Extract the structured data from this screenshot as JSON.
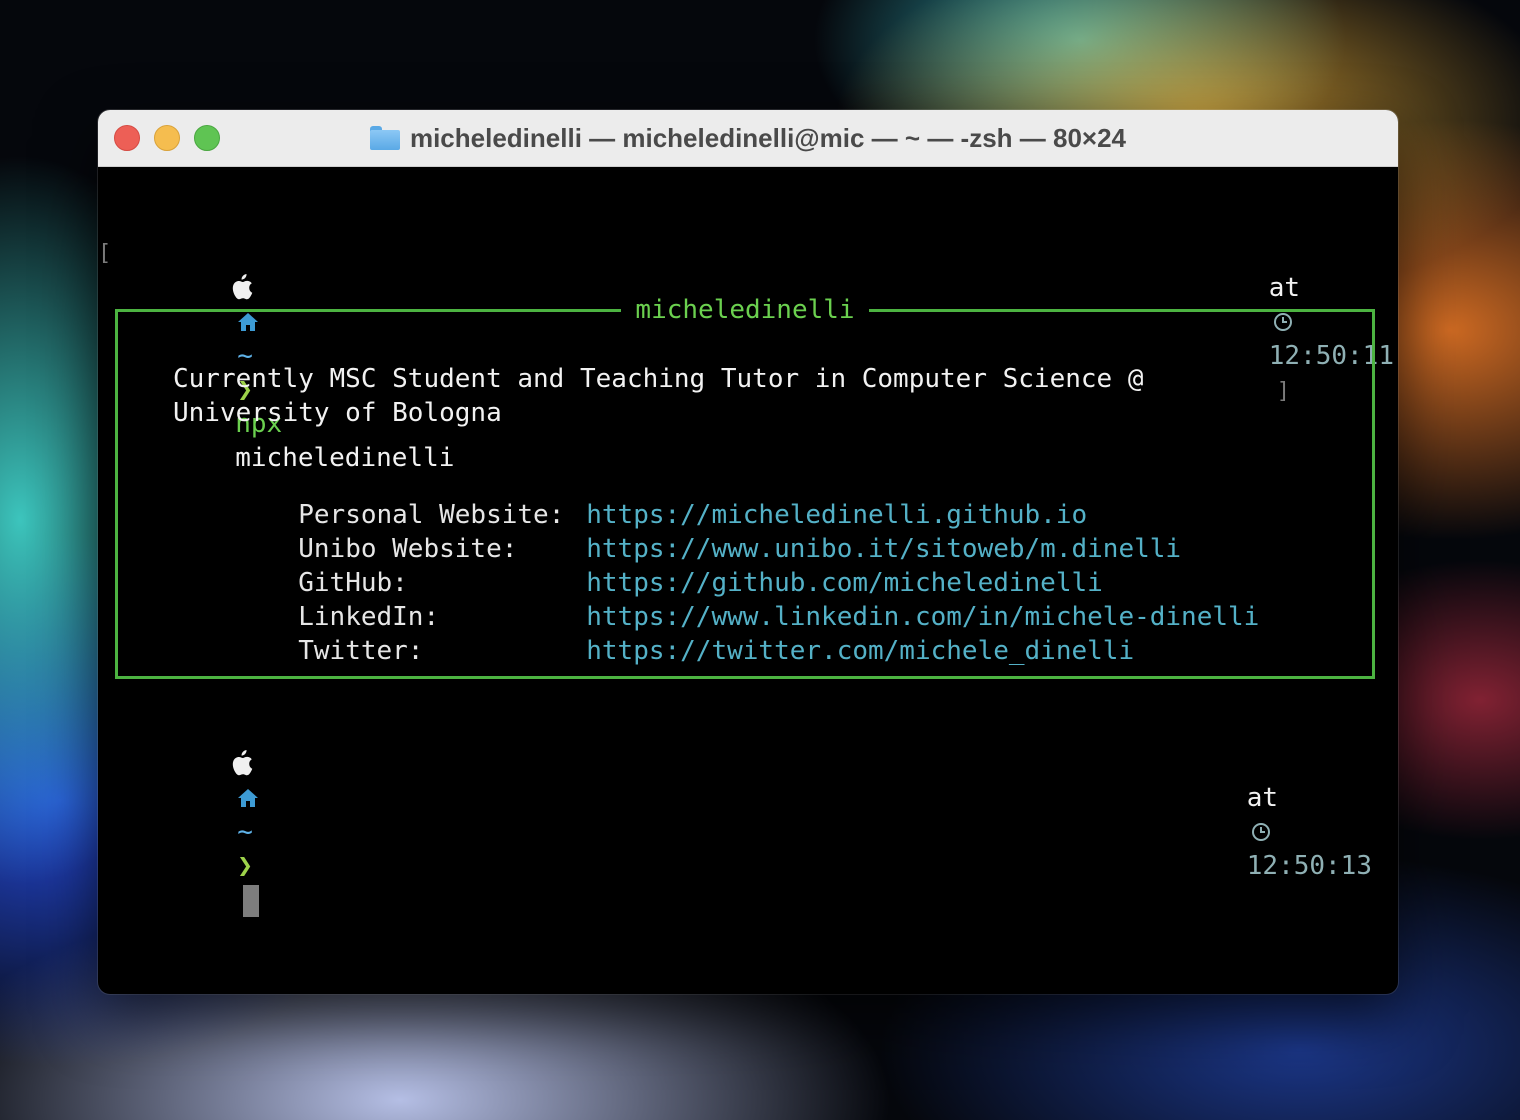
{
  "window": {
    "title": "micheledinelli — micheledinelli@mic — ~ — -zsh — 80×24",
    "buttons": [
      "close",
      "minimize",
      "maximize"
    ]
  },
  "prompt1": {
    "open_bracket": "[",
    "apple": "",
    "home": "🏠",
    "dir": "~",
    "chevron": "❯",
    "cmd": "npx",
    "arg": "micheledinelli",
    "at": "at",
    "clock": "◷",
    "time": "12:50:11",
    "close_bracket": "]"
  },
  "card": {
    "title": "micheledinelli",
    "bio_line1": "Currently MSC Student and Teaching Tutor in Computer Science @",
    "bio_line2": "University of Bologna",
    "links": [
      {
        "label": "Personal Website:",
        "url": "https://micheledinelli.github.io"
      },
      {
        "label": "Unibo Website:",
        "url": "https://www.unibo.it/sitoweb/m.dinelli"
      },
      {
        "label": "GitHub:",
        "url": "https://github.com/micheledinelli"
      },
      {
        "label": "LinkedIn:",
        "url": "https://www.linkedin.com/in/michele-dinelli"
      },
      {
        "label": "Twitter:",
        "url": "https://twitter.com/michele_dinelli"
      }
    ]
  },
  "prompt2": {
    "apple": "",
    "home": "🏠",
    "dir": "~",
    "chevron": "❯",
    "at": "at",
    "clock": "◷",
    "time": "12:50:13"
  },
  "colors": {
    "border_green": "#4cb341",
    "link_cyan": "#54b1c7",
    "prompt_green": "#6bd04f"
  }
}
